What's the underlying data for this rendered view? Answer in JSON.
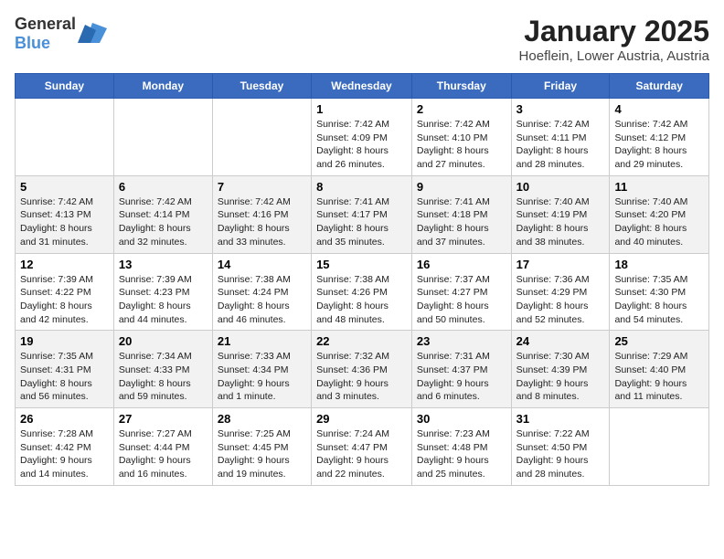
{
  "header": {
    "logo_general": "General",
    "logo_blue": "Blue",
    "title": "January 2025",
    "subtitle": "Hoeflein, Lower Austria, Austria"
  },
  "weekdays": [
    "Sunday",
    "Monday",
    "Tuesday",
    "Wednesday",
    "Thursday",
    "Friday",
    "Saturday"
  ],
  "weeks": [
    [
      {
        "day": "",
        "sunrise": "",
        "sunset": "",
        "daylight": ""
      },
      {
        "day": "",
        "sunrise": "",
        "sunset": "",
        "daylight": ""
      },
      {
        "day": "",
        "sunrise": "",
        "sunset": "",
        "daylight": ""
      },
      {
        "day": "1",
        "sunrise": "Sunrise: 7:42 AM",
        "sunset": "Sunset: 4:09 PM",
        "daylight": "Daylight: 8 hours and 26 minutes."
      },
      {
        "day": "2",
        "sunrise": "Sunrise: 7:42 AM",
        "sunset": "Sunset: 4:10 PM",
        "daylight": "Daylight: 8 hours and 27 minutes."
      },
      {
        "day": "3",
        "sunrise": "Sunrise: 7:42 AM",
        "sunset": "Sunset: 4:11 PM",
        "daylight": "Daylight: 8 hours and 28 minutes."
      },
      {
        "day": "4",
        "sunrise": "Sunrise: 7:42 AM",
        "sunset": "Sunset: 4:12 PM",
        "daylight": "Daylight: 8 hours and 29 minutes."
      }
    ],
    [
      {
        "day": "5",
        "sunrise": "Sunrise: 7:42 AM",
        "sunset": "Sunset: 4:13 PM",
        "daylight": "Daylight: 8 hours and 31 minutes."
      },
      {
        "day": "6",
        "sunrise": "Sunrise: 7:42 AM",
        "sunset": "Sunset: 4:14 PM",
        "daylight": "Daylight: 8 hours and 32 minutes."
      },
      {
        "day": "7",
        "sunrise": "Sunrise: 7:42 AM",
        "sunset": "Sunset: 4:16 PM",
        "daylight": "Daylight: 8 hours and 33 minutes."
      },
      {
        "day": "8",
        "sunrise": "Sunrise: 7:41 AM",
        "sunset": "Sunset: 4:17 PM",
        "daylight": "Daylight: 8 hours and 35 minutes."
      },
      {
        "day": "9",
        "sunrise": "Sunrise: 7:41 AM",
        "sunset": "Sunset: 4:18 PM",
        "daylight": "Daylight: 8 hours and 37 minutes."
      },
      {
        "day": "10",
        "sunrise": "Sunrise: 7:40 AM",
        "sunset": "Sunset: 4:19 PM",
        "daylight": "Daylight: 8 hours and 38 minutes."
      },
      {
        "day": "11",
        "sunrise": "Sunrise: 7:40 AM",
        "sunset": "Sunset: 4:20 PM",
        "daylight": "Daylight: 8 hours and 40 minutes."
      }
    ],
    [
      {
        "day": "12",
        "sunrise": "Sunrise: 7:39 AM",
        "sunset": "Sunset: 4:22 PM",
        "daylight": "Daylight: 8 hours and 42 minutes."
      },
      {
        "day": "13",
        "sunrise": "Sunrise: 7:39 AM",
        "sunset": "Sunset: 4:23 PM",
        "daylight": "Daylight: 8 hours and 44 minutes."
      },
      {
        "day": "14",
        "sunrise": "Sunrise: 7:38 AM",
        "sunset": "Sunset: 4:24 PM",
        "daylight": "Daylight: 8 hours and 46 minutes."
      },
      {
        "day": "15",
        "sunrise": "Sunrise: 7:38 AM",
        "sunset": "Sunset: 4:26 PM",
        "daylight": "Daylight: 8 hours and 48 minutes."
      },
      {
        "day": "16",
        "sunrise": "Sunrise: 7:37 AM",
        "sunset": "Sunset: 4:27 PM",
        "daylight": "Daylight: 8 hours and 50 minutes."
      },
      {
        "day": "17",
        "sunrise": "Sunrise: 7:36 AM",
        "sunset": "Sunset: 4:29 PM",
        "daylight": "Daylight: 8 hours and 52 minutes."
      },
      {
        "day": "18",
        "sunrise": "Sunrise: 7:35 AM",
        "sunset": "Sunset: 4:30 PM",
        "daylight": "Daylight: 8 hours and 54 minutes."
      }
    ],
    [
      {
        "day": "19",
        "sunrise": "Sunrise: 7:35 AM",
        "sunset": "Sunset: 4:31 PM",
        "daylight": "Daylight: 8 hours and 56 minutes."
      },
      {
        "day": "20",
        "sunrise": "Sunrise: 7:34 AM",
        "sunset": "Sunset: 4:33 PM",
        "daylight": "Daylight: 8 hours and 59 minutes."
      },
      {
        "day": "21",
        "sunrise": "Sunrise: 7:33 AM",
        "sunset": "Sunset: 4:34 PM",
        "daylight": "Daylight: 9 hours and 1 minute."
      },
      {
        "day": "22",
        "sunrise": "Sunrise: 7:32 AM",
        "sunset": "Sunset: 4:36 PM",
        "daylight": "Daylight: 9 hours and 3 minutes."
      },
      {
        "day": "23",
        "sunrise": "Sunrise: 7:31 AM",
        "sunset": "Sunset: 4:37 PM",
        "daylight": "Daylight: 9 hours and 6 minutes."
      },
      {
        "day": "24",
        "sunrise": "Sunrise: 7:30 AM",
        "sunset": "Sunset: 4:39 PM",
        "daylight": "Daylight: 9 hours and 8 minutes."
      },
      {
        "day": "25",
        "sunrise": "Sunrise: 7:29 AM",
        "sunset": "Sunset: 4:40 PM",
        "daylight": "Daylight: 9 hours and 11 minutes."
      }
    ],
    [
      {
        "day": "26",
        "sunrise": "Sunrise: 7:28 AM",
        "sunset": "Sunset: 4:42 PM",
        "daylight": "Daylight: 9 hours and 14 minutes."
      },
      {
        "day": "27",
        "sunrise": "Sunrise: 7:27 AM",
        "sunset": "Sunset: 4:44 PM",
        "daylight": "Daylight: 9 hours and 16 minutes."
      },
      {
        "day": "28",
        "sunrise": "Sunrise: 7:25 AM",
        "sunset": "Sunset: 4:45 PM",
        "daylight": "Daylight: 9 hours and 19 minutes."
      },
      {
        "day": "29",
        "sunrise": "Sunrise: 7:24 AM",
        "sunset": "Sunset: 4:47 PM",
        "daylight": "Daylight: 9 hours and 22 minutes."
      },
      {
        "day": "30",
        "sunrise": "Sunrise: 7:23 AM",
        "sunset": "Sunset: 4:48 PM",
        "daylight": "Daylight: 9 hours and 25 minutes."
      },
      {
        "day": "31",
        "sunrise": "Sunrise: 7:22 AM",
        "sunset": "Sunset: 4:50 PM",
        "daylight": "Daylight: 9 hours and 28 minutes."
      },
      {
        "day": "",
        "sunrise": "",
        "sunset": "",
        "daylight": ""
      }
    ]
  ]
}
